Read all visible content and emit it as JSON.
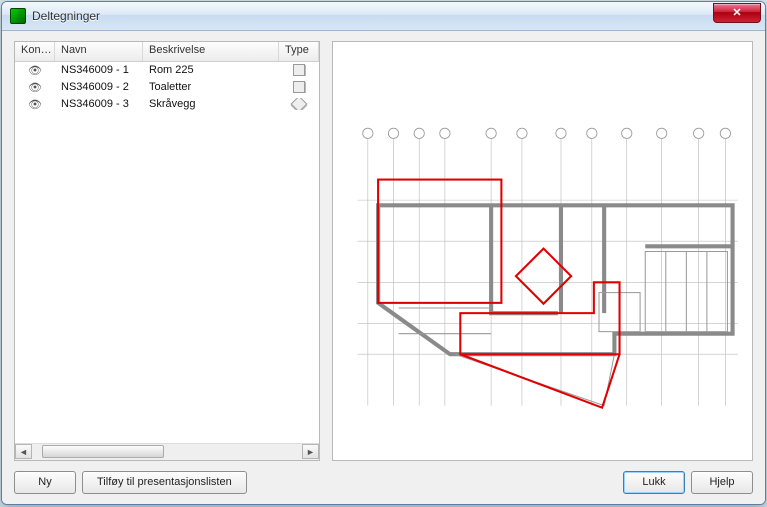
{
  "window": {
    "title": "Deltegninger"
  },
  "columns": {
    "kon": "Kon…",
    "navn": "Navn",
    "besk": "Beskrivelse",
    "type": "Type"
  },
  "rows": [
    {
      "navn": "NS346009 - 1",
      "besk": "Rom 225",
      "type": "square"
    },
    {
      "navn": "NS346009 - 2",
      "besk": "Toaletter",
      "type": "square"
    },
    {
      "navn": "NS346009 - 3",
      "besk": "Skråvegg",
      "type": "diamond"
    }
  ],
  "buttons": {
    "ny": "Ny",
    "tilfoy": "Tilføy til presentasjonslisten",
    "lukk": "Lukk",
    "hjelp": "Hjelp"
  }
}
